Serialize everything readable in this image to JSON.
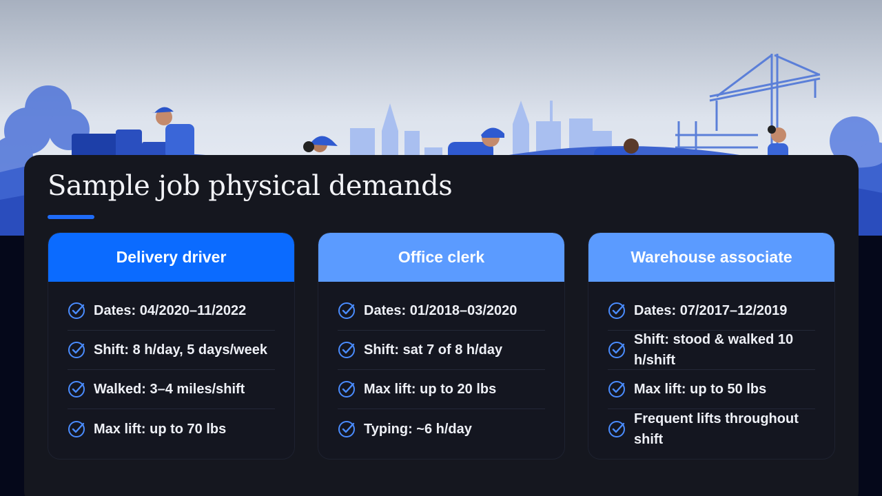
{
  "slide": {
    "title": "Sample job physical demands"
  },
  "colors": {
    "accent": "#1f6cf7",
    "header_primary": "#0b6bff",
    "header_secondary": "#5b9bff",
    "panel": "#15171f",
    "check": "#4a8cff"
  },
  "cards": [
    {
      "header": "Delivery driver",
      "items": [
        "Dates: 04/2020–11/2022",
        "Shift: 8 h/day, 5 days/week",
        "Walked: 3–4 miles/shift",
        "Max lift: up to 70 lbs"
      ]
    },
    {
      "header": "Office clerk",
      "items": [
        "Dates: 01/2018–03/2020",
        "Shift: sat 7 of 8 h/day",
        "Max lift: up to 20 lbs",
        "Typing: ~6 h/day"
      ]
    },
    {
      "header": "Warehouse associate",
      "items": [
        "Dates: 07/2017–12/2019",
        "Shift: stood & walked 10 h/shift",
        "Max lift: up to 50 lbs",
        "Frequent lifts throughout shift"
      ]
    }
  ],
  "icons": {
    "item": "check-circle-icon"
  }
}
